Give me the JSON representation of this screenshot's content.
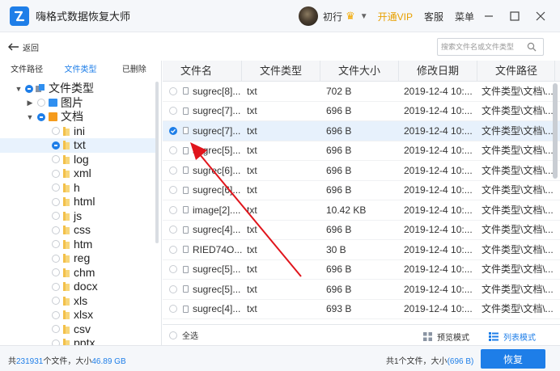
{
  "window": {
    "title": "嗨格式数据恢复大师",
    "username": "初行",
    "vip_link": "开通VIP",
    "service_link": "客服",
    "menu_link": "菜单"
  },
  "toolbar": {
    "back_label": "返回",
    "search_placeholder": "搜索文件名或文件类型"
  },
  "left_tabs": [
    "文件路径",
    "文件类型",
    "已删除"
  ],
  "tree": {
    "root": "文件类型",
    "image": "图片",
    "document": "文档",
    "types": [
      "ini",
      "txt",
      "log",
      "xml",
      "h",
      "html",
      "js",
      "css",
      "htm",
      "reg",
      "chm",
      "docx",
      "xls",
      "xlsx",
      "csv",
      "pptx"
    ]
  },
  "table": {
    "headers": [
      "文件名",
      "文件类型",
      "文件大小",
      "修改日期",
      "文件路径"
    ],
    "rows": [
      {
        "name": "sugrec[8]...",
        "type": "txt",
        "size": "702 B",
        "date": "2019-12-4 10:...",
        "path": "文件类型\\文档\\..."
      },
      {
        "name": "sugrec[7]...",
        "type": "txt",
        "size": "696 B",
        "date": "2019-12-4 10:...",
        "path": "文件类型\\文档\\..."
      },
      {
        "name": "sugrec[7]...",
        "type": "txt",
        "size": "696 B",
        "date": "2019-12-4 10:...",
        "path": "文件类型\\文档\\..."
      },
      {
        "name": "sugrec[5]...",
        "type": "txt",
        "size": "696 B",
        "date": "2019-12-4 10:...",
        "path": "文件类型\\文档\\..."
      },
      {
        "name": "sugrec[6]...",
        "type": "txt",
        "size": "696 B",
        "date": "2019-12-4 10:...",
        "path": "文件类型\\文档\\..."
      },
      {
        "name": "sugrec[6]...",
        "type": "txt",
        "size": "696 B",
        "date": "2019-12-4 10:...",
        "path": "文件类型\\文档\\..."
      },
      {
        "name": "image[2]....",
        "type": "txt",
        "size": "10.42 KB",
        "date": "2019-12-4 10:...",
        "path": "文件类型\\文档\\..."
      },
      {
        "name": "sugrec[4]...",
        "type": "txt",
        "size": "696 B",
        "date": "2019-12-4 10:...",
        "path": "文件类型\\文档\\..."
      },
      {
        "name": "RIED74O...",
        "type": "txt",
        "size": "30 B",
        "date": "2019-12-4 10:...",
        "path": "文件类型\\文档\\..."
      },
      {
        "name": "sugrec[5]...",
        "type": "txt",
        "size": "696 B",
        "date": "2019-12-4 10:...",
        "path": "文件类型\\文档\\..."
      },
      {
        "name": "sugrec[5]...",
        "type": "txt",
        "size": "696 B",
        "date": "2019-12-4 10:...",
        "path": "文件类型\\文档\\..."
      },
      {
        "name": "sugrec[4]...",
        "type": "txt",
        "size": "693 B",
        "date": "2019-12-4 10:...",
        "path": "文件类型\\文档\\..."
      }
    ]
  },
  "footer": {
    "select_all": "全选",
    "preview_mode": "预览模式",
    "list_mode": "列表模式"
  },
  "status": {
    "total_prefix": "共",
    "total_count": "231931",
    "total_mid": "个文件，大小",
    "total_size": "46.89 GB",
    "selected_text": "共1个文件，大小",
    "selected_size": "(696 B)",
    "recover_button": "恢复"
  },
  "colors": {
    "accent": "#1e7ee8",
    "vip": "#e8a000",
    "annotation_arrow": "#e0151c"
  }
}
